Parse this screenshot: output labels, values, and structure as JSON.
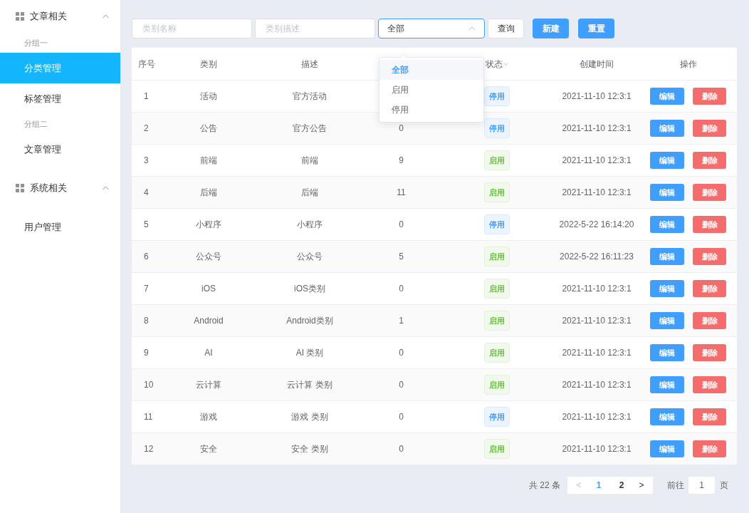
{
  "sidebar": {
    "groups": [
      {
        "title": "文章相关",
        "expanded": true,
        "items": [
          {
            "kind": "group_label",
            "label": "分组一"
          },
          {
            "kind": "item",
            "label": "分类管理",
            "selected": true
          },
          {
            "kind": "item",
            "label": "标签管理",
            "selected": false
          },
          {
            "kind": "group_label",
            "label": "分组二"
          },
          {
            "kind": "item",
            "label": "文章管理",
            "selected": false
          }
        ]
      },
      {
        "title": "系统相关",
        "expanded": true,
        "items": [
          {
            "kind": "item",
            "label": "用户管理",
            "selected": false
          }
        ]
      }
    ]
  },
  "filters": {
    "name_placeholder": "类别名称",
    "desc_placeholder": "类别描述",
    "status_select": {
      "value": "全部",
      "open": true,
      "options": [
        {
          "label": "全部",
          "selected": true
        },
        {
          "label": "启用",
          "selected": false
        },
        {
          "label": "停用",
          "selected": false
        }
      ]
    },
    "query_button": "查询",
    "new_button": "新建",
    "reset_button": "重置"
  },
  "table": {
    "columns": {
      "index": "序号",
      "category": "类别",
      "description": "描述",
      "status": "状态",
      "created": "创建时间",
      "actions": "操作"
    },
    "rows": [
      {
        "index": "1",
        "category": "活动",
        "description": "官方活动",
        "status": "停用",
        "enabled": false,
        "created": "2021-11-10 12:3:1",
        "edit": "编辑",
        "delete": "删除"
      },
      {
        "index": "2",
        "category": "公告",
        "description": "官方公告",
        "count": "0",
        "status": "停用",
        "enabled": false,
        "created": "2021-11-10 12:3:1",
        "edit": "编辑",
        "delete": "删除"
      },
      {
        "index": "3",
        "category": "前端",
        "description": "前端",
        "count": "9",
        "status": "启用",
        "enabled": true,
        "created": "2021-11-10 12:3:1",
        "edit": "编辑",
        "delete": "删除"
      },
      {
        "index": "4",
        "category": "后端",
        "description": "后端",
        "count": "11",
        "status": "启用",
        "enabled": true,
        "created": "2021-11-10 12:3:1",
        "edit": "编辑",
        "delete": "删除"
      },
      {
        "index": "5",
        "category": "小程序",
        "description": "小程序",
        "count": "0",
        "status": "停用",
        "enabled": false,
        "created": "2022-5-22 16:14:20",
        "edit": "编辑",
        "delete": "删除"
      },
      {
        "index": "6",
        "category": "公众号",
        "description": "公众号",
        "count": "5",
        "status": "启用",
        "enabled": true,
        "created": "2022-5-22 16:11:23",
        "edit": "编辑",
        "delete": "删除"
      },
      {
        "index": "7",
        "category": "iOS",
        "description": "iOS类别",
        "count": "0",
        "status": "启用",
        "enabled": true,
        "created": "2021-11-10 12:3:1",
        "edit": "编辑",
        "delete": "删除"
      },
      {
        "index": "8",
        "category": "Android",
        "description": "Android类别",
        "count": "1",
        "status": "启用",
        "enabled": true,
        "created": "2021-11-10 12:3:1",
        "edit": "编辑",
        "delete": "删除"
      },
      {
        "index": "9",
        "category": "AI",
        "description": "AI 类别",
        "count": "0",
        "status": "启用",
        "enabled": true,
        "created": "2021-11-10 12:3:1",
        "edit": "编辑",
        "delete": "删除"
      },
      {
        "index": "10",
        "category": "云计算",
        "description": "云计算 类别",
        "count": "0",
        "status": "启用",
        "enabled": true,
        "created": "2021-11-10 12:3:1",
        "edit": "编辑",
        "delete": "删除"
      },
      {
        "index": "11",
        "category": "游戏",
        "description": "游戏 类别",
        "count": "0",
        "status": "停用",
        "enabled": false,
        "created": "2021-11-10 12:3:1",
        "edit": "编辑",
        "delete": "删除"
      },
      {
        "index": "12",
        "category": "安全",
        "description": "安全 类别",
        "count": "0",
        "status": "启用",
        "enabled": true,
        "created": "2021-11-10 12:3:1",
        "edit": "编辑",
        "delete": "删除"
      }
    ]
  },
  "pagination": {
    "total": "共 22 条",
    "prev": "<",
    "pages": [
      {
        "label": "1",
        "selected": true
      },
      {
        "label": "2",
        "selected": false
      }
    ],
    "next": ">",
    "goto_label": "前往",
    "goto_value": "1",
    "page_suffix": "页"
  }
}
